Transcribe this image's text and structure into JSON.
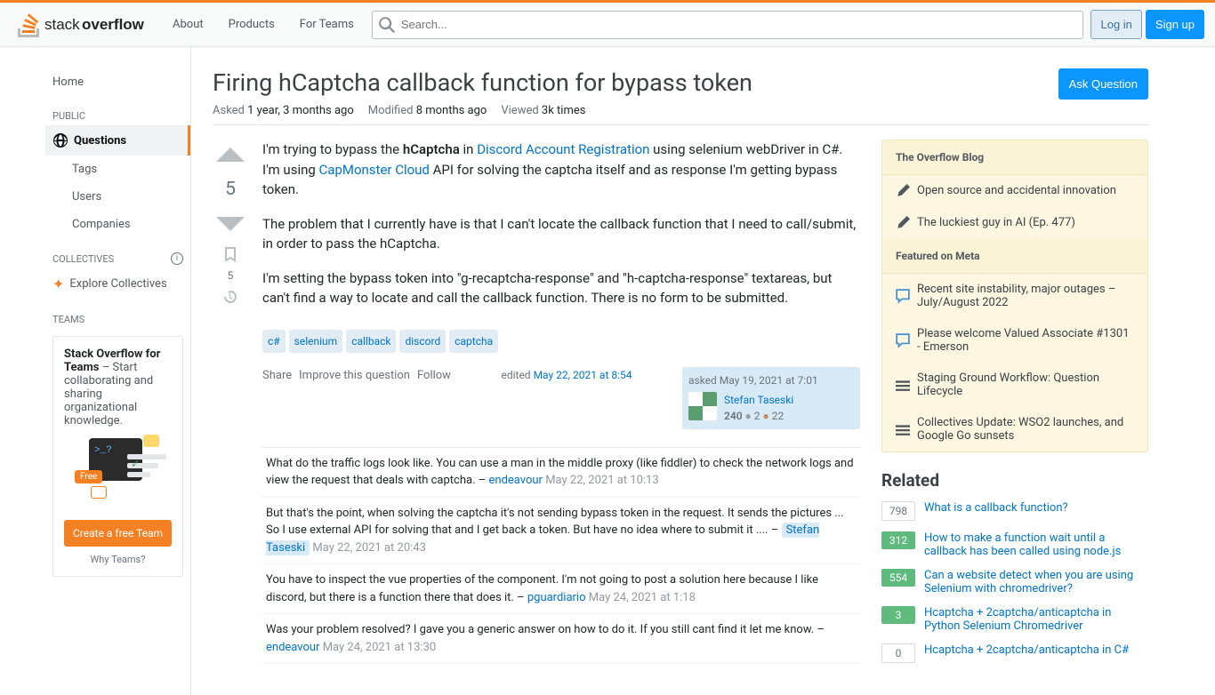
{
  "header": {
    "logo_alt": "Stack Overflow",
    "nav": {
      "about": "About",
      "products": "Products",
      "for_teams": "For Teams"
    },
    "search_placeholder": "Search...",
    "login": "Log in",
    "signup": "Sign up"
  },
  "left_nav": {
    "home": "Home",
    "public": "PUBLIC",
    "questions": "Questions",
    "tags": "Tags",
    "users": "Users",
    "companies": "Companies",
    "collectives": "COLLECTIVES",
    "explore": "Explore Collectives",
    "teams": "TEAMS",
    "teams_box_bold": "Stack Overflow for Teams",
    "teams_box_text": " – Start collaborating and sharing organizational knowledge.",
    "teams_free": "Free",
    "teams_cta": "Create a free Team",
    "teams_why": "Why Teams?"
  },
  "question": {
    "title": "Firing hCaptcha callback function for bypass token",
    "ask_button": "Ask Question",
    "meta": {
      "asked_label": "Asked",
      "asked_value": "1 year, 3 months ago",
      "modified_label": "Modified",
      "modified_value": "8 months ago",
      "viewed_label": "Viewed",
      "viewed_value": "3k times"
    },
    "vote_count": "5",
    "bookmark_count": "5",
    "body": {
      "p1_a": "I'm trying to bypass the ",
      "p1_b": "hCaptcha",
      "p1_c": " in ",
      "p1_link1": "Discord Account Registration",
      "p1_d": " using selenium webDriver in C#. I'm using ",
      "p1_link2": "CapMonster Cloud",
      "p1_e": " API for solving the captcha itself and as response I'm getting bypass token.",
      "p2": "The problem that I currently have is that I can't locate the callback function that I need to call/submit, in order to pass the hCaptcha.",
      "p3": "I'm setting the bypass token into \"g-recaptcha-response\" and \"h-captcha-response\" textareas, but can't find a way to locate and call the callback function. There is no form to be submitted."
    },
    "tags": [
      "c#",
      "selenium",
      "callback",
      "discord",
      "captcha"
    ],
    "actions": {
      "share": "Share",
      "improve": "Improve this question",
      "follow": "Follow"
    },
    "edited": {
      "prefix": "edited ",
      "time": "May 22, 2021 at 8:54"
    },
    "user": {
      "asked_prefix": "asked ",
      "asked_time": "May 19, 2021 at 7:01",
      "name": "Stefan Taseski",
      "rep": "240",
      "silver": "2",
      "bronze": "22"
    }
  },
  "comments": [
    {
      "text": "What do the traffic logs look like. You can use a man in the middle proxy (like fiddler) to check the network logs and view the request that deals with captcha.",
      "sep": " – ",
      "user": "endeavour",
      "time": "May 22, 2021 at 10:13",
      "owner": false
    },
    {
      "text": "But that's the point, when solving the captcha it's not sending bypass token in the request. It sends the pictures ... So I use external API for solving that and I get back a token. But have no idea where to submit it ....",
      "sep": " – ",
      "user": "Stefan Taseski",
      "time": "May 22, 2021 at 20:43",
      "owner": true
    },
    {
      "text": "You have to inspect the vue properties of the component. I'm not going to post a solution here because I like discord, but there is a function there that does it.",
      "sep": " – ",
      "user": "pguardiario",
      "time": "May 24, 2021 at 1:18",
      "owner": false
    },
    {
      "text": "Was your problem resolved? I gave you a generic answer on how to do it. If you still cant find it let me know.",
      "sep": " – ",
      "user": "endeavour",
      "time": "May 24, 2021 at 13:30",
      "owner": false
    }
  ],
  "sidebar": {
    "overflow_blog": "The Overflow Blog",
    "blog_items": [
      "Open source and accidental innovation",
      "The luckiest guy in AI (Ep. 477)"
    ],
    "featured": "Featured on Meta",
    "meta_items": [
      "Recent site instability, major outages – July/August 2022",
      "Please welcome Valued Associate #1301 - Emerson",
      "Staging Ground Workflow: Question Lifecycle",
      "Collectives Update: WSO2 launches, and Google Go sunsets"
    ],
    "related": "Related",
    "related_items": [
      {
        "count": "798",
        "cls": "lc-white",
        "title": "What is a callback function?"
      },
      {
        "count": "312",
        "cls": "lc-answered",
        "title": "How to make a function wait until a callback has been called using node.js"
      },
      {
        "count": "554",
        "cls": "lc-answered",
        "title": "Can a website detect when you are using Selenium with chromedriver?"
      },
      {
        "count": "3",
        "cls": "lc-answered",
        "title": "Hcaptcha + 2captcha/anticaptcha in Python Selenium Chromedriver"
      },
      {
        "count": "0",
        "cls": "lc-white",
        "title": "Hcaptcha + 2captcha/anticaptcha in C#"
      }
    ]
  }
}
